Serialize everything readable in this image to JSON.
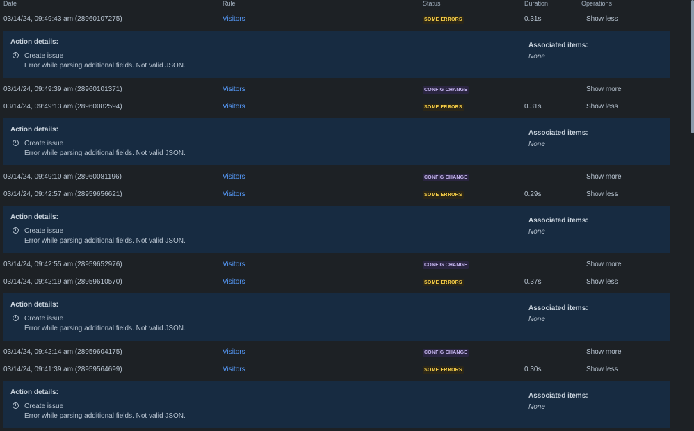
{
  "header": {
    "date": "Date",
    "rule": "Rule",
    "status": "Status",
    "duration": "Duration",
    "operations": "Operations"
  },
  "rows": [
    {
      "date": "03/14/24, 09:49:43 am (28960107275)",
      "rule": "Visitors",
      "status": "SOME ERRORS",
      "duration": "0.31s",
      "op": "Show less"
    },
    {
      "date": "03/14/24, 09:49:39 am (28960101371)",
      "rule": "Visitors",
      "status": "CONFIG CHANGE",
      "duration": "",
      "op": "Show more"
    },
    {
      "date": "03/14/24, 09:49:13 am (28960082594)",
      "rule": "Visitors",
      "status": "SOME ERRORS",
      "duration": "0.31s",
      "op": "Show less"
    },
    {
      "date": "03/14/24, 09:49:10 am (28960081196)",
      "rule": "Visitors",
      "status": "CONFIG CHANGE",
      "duration": "",
      "op": "Show more"
    },
    {
      "date": "03/14/24, 09:42:57 am (28959656621)",
      "rule": "Visitors",
      "status": "SOME ERRORS",
      "duration": "0.29s",
      "op": "Show less"
    },
    {
      "date": "03/14/24, 09:42:55 am (28959652976)",
      "rule": "Visitors",
      "status": "CONFIG CHANGE",
      "duration": "",
      "op": "Show more"
    },
    {
      "date": "03/14/24, 09:42:19 am (28959610570)",
      "rule": "Visitors",
      "status": "SOME ERRORS",
      "duration": "0.37s",
      "op": "Show less"
    },
    {
      "date": "03/14/24, 09:42:14 am (28959604175)",
      "rule": "Visitors",
      "status": "CONFIG CHANGE",
      "duration": "",
      "op": "Show more"
    },
    {
      "date": "03/14/24, 09:41:39 am (28959564699)",
      "rule": "Visitors",
      "status": "SOME ERRORS",
      "duration": "0.30s",
      "op": "Show less"
    }
  ],
  "details": {
    "title": "Action details:",
    "action": "Create issue",
    "message": "Error while parsing additional fields. Not valid JSON.",
    "assoc_label": "Associated items:",
    "assoc_value": "None"
  },
  "icons": {
    "info": "info-icon"
  },
  "colors": {
    "background": "#1d2125",
    "details_bg": "#172b41",
    "link": "#579dff",
    "error_badge": "#f5cd47",
    "config_badge": "#c6b6f0"
  }
}
